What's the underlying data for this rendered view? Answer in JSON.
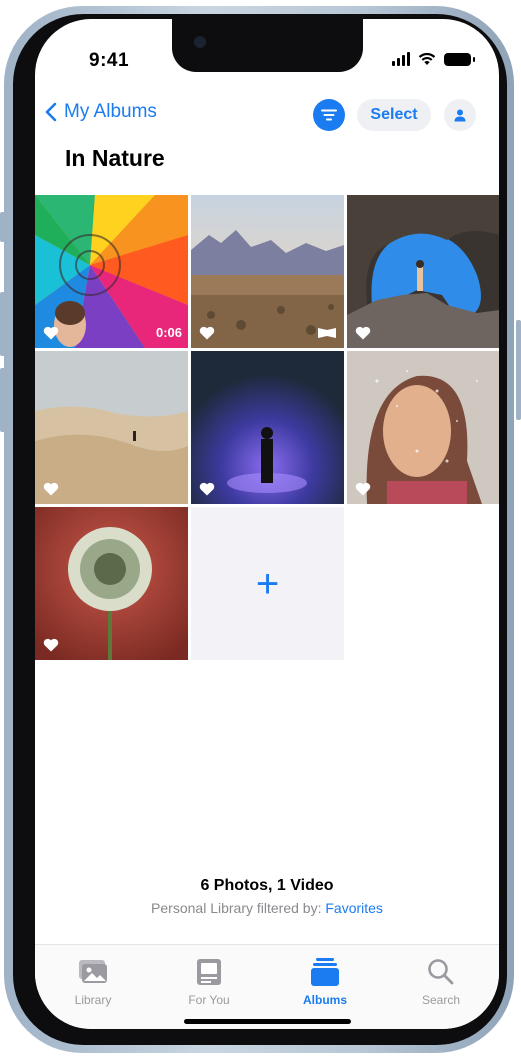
{
  "status_bar": {
    "time": "9:41"
  },
  "nav": {
    "back_label": "My Albums",
    "select_label": "Select"
  },
  "album": {
    "title": "In Nature"
  },
  "grid": {
    "items": [
      {
        "kind": "video",
        "favorite": true,
        "duration": "0:06"
      },
      {
        "kind": "panorama",
        "favorite": true
      },
      {
        "kind": "photo",
        "favorite": true
      },
      {
        "kind": "photo",
        "favorite": true
      },
      {
        "kind": "photo",
        "favorite": true
      },
      {
        "kind": "photo",
        "favorite": true
      },
      {
        "kind": "photo",
        "favorite": true
      }
    ],
    "add_symbol": "+"
  },
  "summary": {
    "count_text": "6 Photos, 1 Video",
    "filter_prefix": "Personal Library filtered by:",
    "filter_value": "Favorites"
  },
  "tabbar": {
    "tabs": [
      {
        "label": "Library",
        "icon": "library-icon"
      },
      {
        "label": "For You",
        "icon": "for-you-icon"
      },
      {
        "label": "Albums",
        "icon": "albums-icon",
        "active": true
      },
      {
        "label": "Search",
        "icon": "search-icon"
      }
    ]
  },
  "colors": {
    "accent": "#1a7cf0"
  }
}
